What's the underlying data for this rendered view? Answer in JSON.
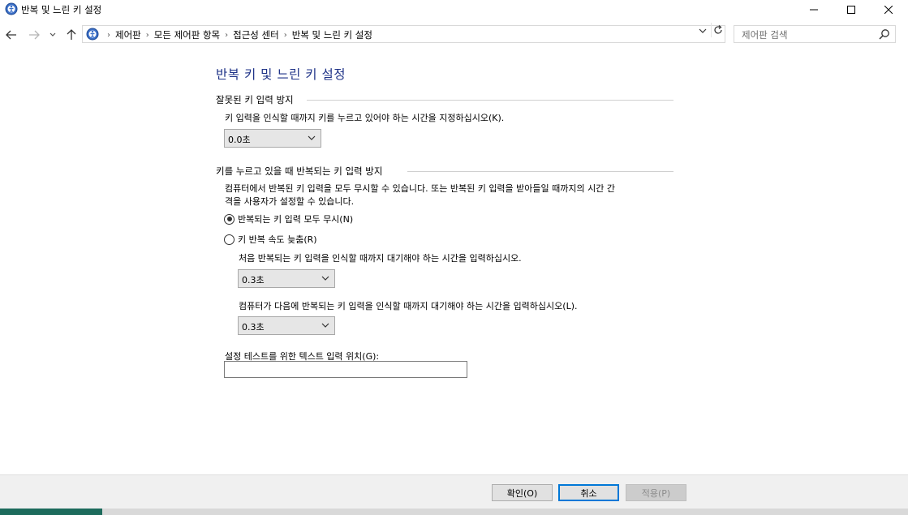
{
  "window": {
    "title": "반복 및 느린 키 설정",
    "icon": "control-panel-icon"
  },
  "nav": {
    "back_icon": "arrow-left-icon",
    "forward_icon": "arrow-right-icon",
    "recent_icon": "chevron-down-icon",
    "up_icon": "arrow-up-icon"
  },
  "address": {
    "breadcrumbs": [
      "제어판",
      "모든 제어판 항목",
      "접근성 센터",
      "반복 및 느린 키 설정"
    ]
  },
  "search": {
    "placeholder": "제어판 검색"
  },
  "page": {
    "title": "반복 키 및 느린 키 설정",
    "section1": {
      "heading": "잘못된 키 입력 방지",
      "description": "키 입력을 인식할 때까지 키를 누르고 있어야 하는 시간을 지정하십시오(K).",
      "select_value": "0.0초"
    },
    "section2": {
      "heading": "키를 누르고 있을 때 반복되는 키 입력 방지",
      "description_line1": "컴퓨터에서 반복된 키 입력을 모두 무시할 수 있습니다. 또는 반복된 키 입력을 받아들일 때까지의 시간 간",
      "description_line2": "격을 사용자가 설정할 수 있습니다.",
      "radio_ignore_label": "반복되는 키 입력 모두 무시(N)",
      "radio_slow_label": "키 반복 속도 늦춤(R)",
      "first_delay_label": "처음 반복되는 키 입력을 인식할 때까지 대기해야 하는 시간을 입력하십시오.",
      "first_delay_value": "0.3초",
      "next_delay_label": "컴퓨터가 다음에 반복되는 키 입력을 인식할 때까지 대기해야 하는 시간을 입력하십시오(L).",
      "next_delay_value": "0.3초"
    },
    "test_area": {
      "label": "설정 테스트를 위한 텍스트 입력 위치(G):",
      "value": ""
    }
  },
  "buttons": {
    "ok": "확인(O)",
    "cancel": "취소",
    "apply": "적용(P)"
  },
  "colors": {
    "title_blue": "#1e3287",
    "focus_blue": "#0078d7",
    "taskbar_accent": "#1d6b5c"
  }
}
